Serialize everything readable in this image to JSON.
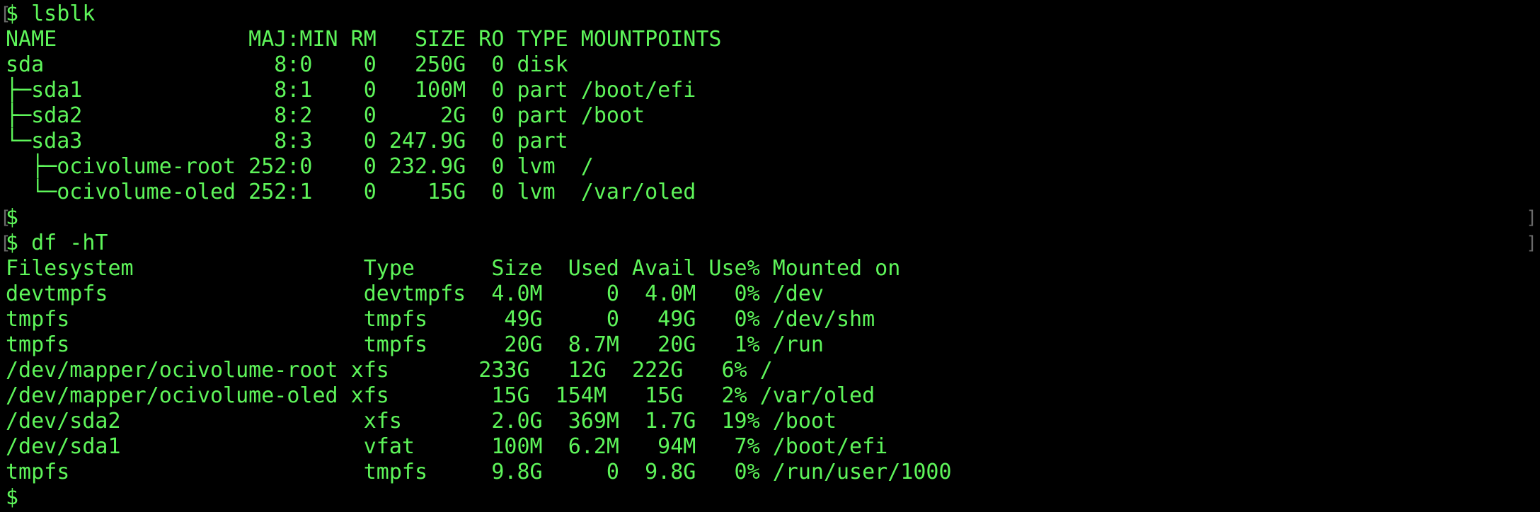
{
  "colors": {
    "background": "#000000",
    "text": "#5ef55a",
    "prompt_bracket": "#6a6a6a"
  },
  "terminal": {
    "lines": [
      {
        "text": "$ lsblk",
        "kind": "command"
      },
      {
        "text": "NAME               MAJ:MIN RM   SIZE RO TYPE MOUNTPOINTS",
        "kind": "header"
      },
      {
        "text": "sda                  8:0    0   250G  0 disk",
        "kind": "output"
      },
      {
        "text": "├─sda1               8:1    0   100M  0 part /boot/efi",
        "kind": "output"
      },
      {
        "text": "├─sda2               8:2    0     2G  0 part /boot",
        "kind": "output"
      },
      {
        "text": "└─sda3               8:3    0 247.9G  0 part",
        "kind": "output"
      },
      {
        "text": "  ├─ocivolume-root 252:0    0 232.9G  0 lvm  /",
        "kind": "output"
      },
      {
        "text": "  └─ocivolume-oled 252:1    0    15G  0 lvm  /var/oled",
        "kind": "output"
      },
      {
        "text": "$",
        "kind": "prompt"
      },
      {
        "text": "$ df -hT",
        "kind": "command"
      },
      {
        "text": "Filesystem                  Type      Size  Used Avail Use% Mounted on",
        "kind": "header"
      },
      {
        "text": "devtmpfs                    devtmpfs  4.0M     0  4.0M   0% /dev",
        "kind": "output"
      },
      {
        "text": "tmpfs                       tmpfs      49G     0   49G   0% /dev/shm",
        "kind": "output"
      },
      {
        "text": "tmpfs                       tmpfs      20G  8.7M   20G   1% /run",
        "kind": "output"
      },
      {
        "text": "/dev/mapper/ocivolume-root xfs       233G   12G  222G   6% /",
        "kind": "output"
      },
      {
        "text": "/dev/mapper/ocivolume-oled xfs        15G  154M   15G   2% /var/oled",
        "kind": "output"
      },
      {
        "text": "/dev/sda2                   xfs       2.0G  369M  1.7G  19% /boot",
        "kind": "output"
      },
      {
        "text": "/dev/sda1                   vfat      100M  6.2M   94M   7% /boot/efi",
        "kind": "output"
      },
      {
        "text": "tmpfs                       tmpfs     9.8G     0  9.8G   0% /run/user/1000",
        "kind": "output"
      },
      {
        "text": "$",
        "kind": "prompt"
      }
    ]
  }
}
